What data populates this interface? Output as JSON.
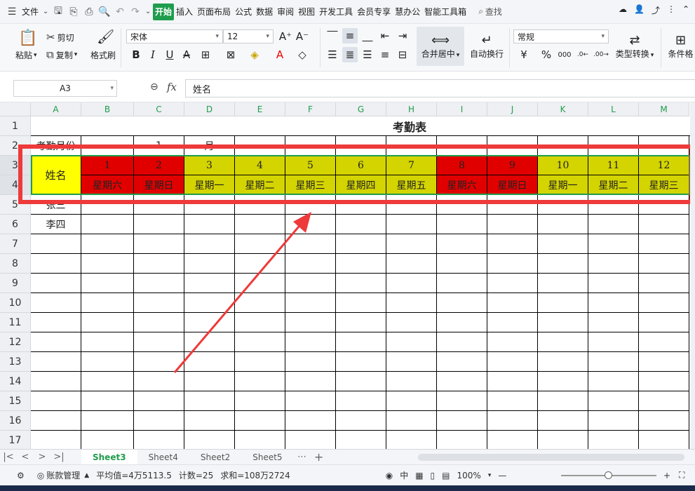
{
  "menu": {
    "file": "文件",
    "tabs": [
      "开始",
      "插入",
      "页面布局",
      "公式",
      "数据",
      "审阅",
      "视图",
      "开发工具",
      "会员专享",
      "慧办公",
      "智能工具箱"
    ],
    "active_tab": "开始",
    "search": "查找"
  },
  "ribbon": {
    "paste": "粘贴",
    "cut": "剪切",
    "copy": "复制",
    "format_painter": "格式刷",
    "font_name": "宋体",
    "font_size": "12",
    "merge_center": "合并居中",
    "wrap_text": "自动换行",
    "number_format": "常规",
    "type_convert": "类型转换",
    "conditional": "条件格"
  },
  "formula_bar": {
    "cell_ref": "A3",
    "fx": "fx",
    "content": "姓名"
  },
  "columns": [
    "A",
    "B",
    "C",
    "D",
    "E",
    "F",
    "G",
    "H",
    "I",
    "J",
    "K",
    "L",
    "M"
  ],
  "rows": [
    "1",
    "2",
    "3",
    "4",
    "5",
    "6",
    "7",
    "8",
    "9",
    "10",
    "11",
    "12",
    "13",
    "14",
    "15",
    "16",
    "17"
  ],
  "sheet": {
    "title": "考勤表",
    "row2": {
      "label": "考勤月份",
      "c": "1",
      "d": "月"
    },
    "header_name": "姓名",
    "days": [
      "1",
      "2",
      "3",
      "4",
      "5",
      "6",
      "7",
      "8",
      "9",
      "10",
      "11",
      "12"
    ],
    "weekdays": [
      "星期六",
      "星期日",
      "星期一",
      "星期二",
      "星期三",
      "星期四",
      "星期五",
      "星期六",
      "星期日",
      "星期一",
      "星期二",
      "星期三"
    ],
    "weekend_flags": [
      true,
      true,
      false,
      false,
      false,
      false,
      false,
      true,
      true,
      false,
      false,
      false
    ],
    "names": [
      "张三",
      "李四"
    ],
    "colors": {
      "weekend": "#e00000",
      "weekday": "#d4d400",
      "name_header": "#ffff00"
    }
  },
  "sheet_tabs": [
    "Sheet3",
    "Sheet4",
    "Sheet2",
    "Sheet5"
  ],
  "active_sheet": "Sheet3",
  "status": {
    "account": "账款管理",
    "average": "平均值=4万5113.5",
    "count": "计数=25",
    "sum": "求和=108万2724",
    "zoom": "100%"
  },
  "annotation_color": "#ee3a3a"
}
